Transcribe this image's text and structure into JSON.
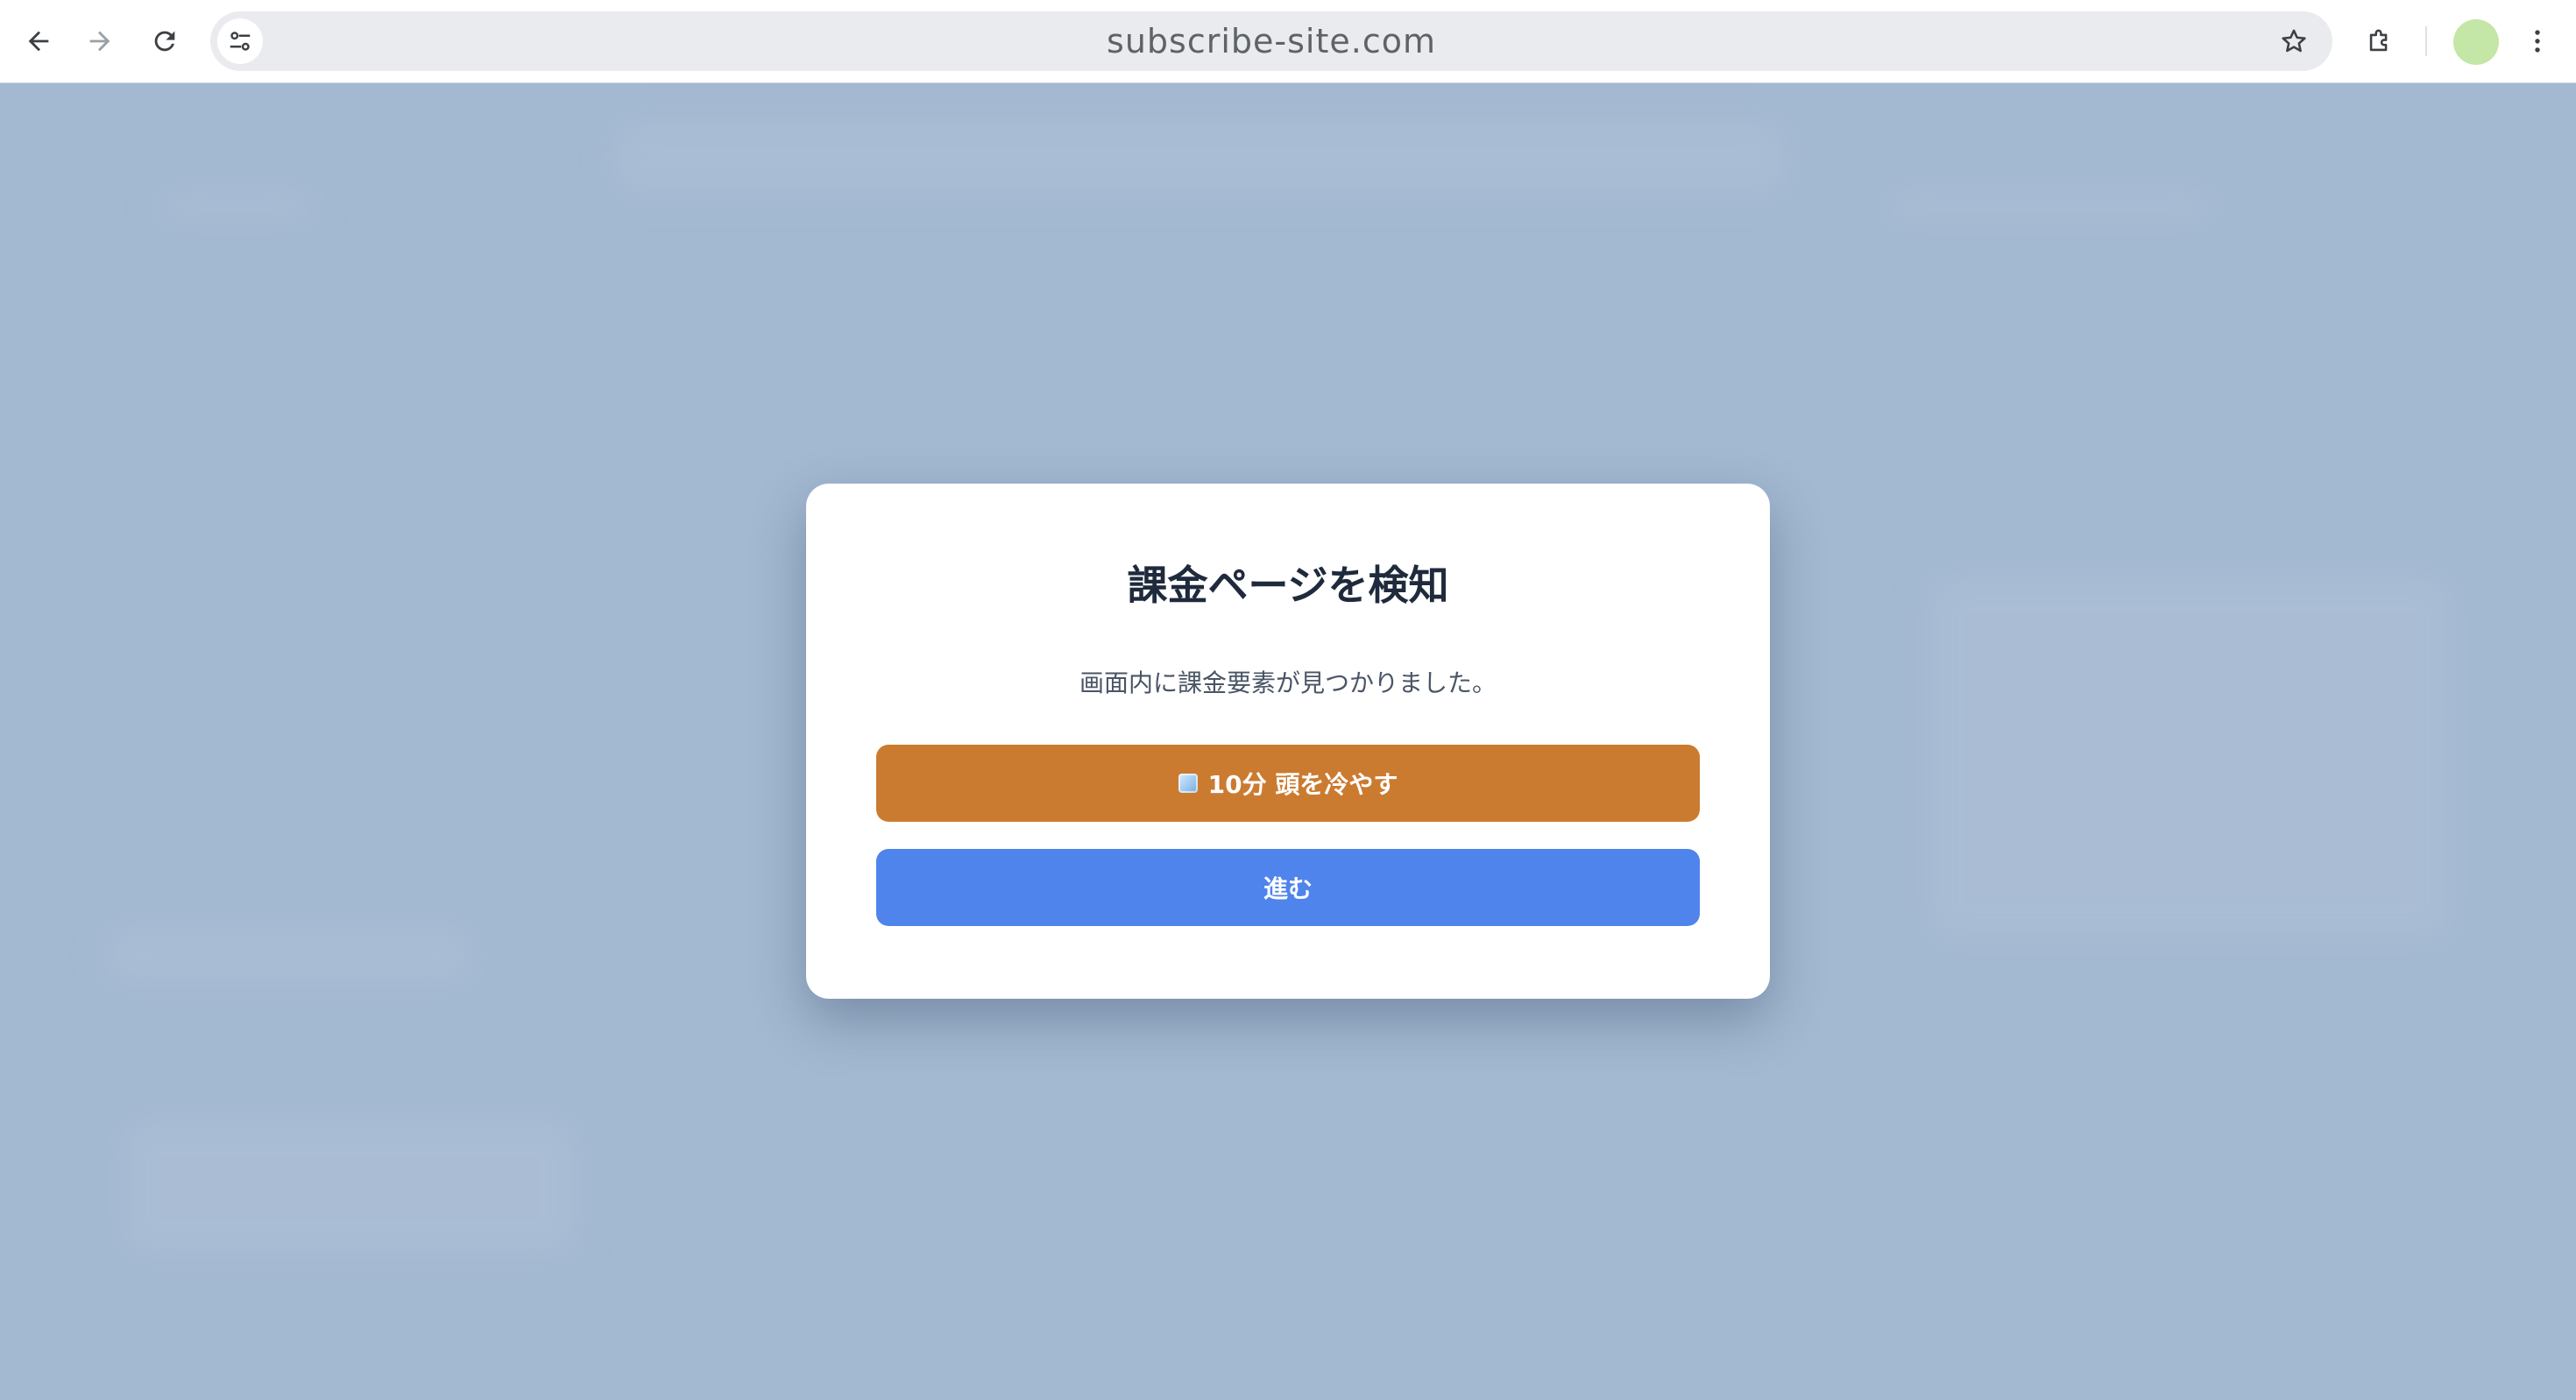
{
  "browser": {
    "url": "subscribe-site.com",
    "icons": {
      "back": "back-arrow-icon",
      "forward": "forward-arrow-icon",
      "reload": "reload-icon",
      "site_info": "tune-icon",
      "bookmark": "star-icon",
      "extensions": "puzzle-icon",
      "menu": "kebab-menu-icon"
    },
    "avatar_color": "#c4e6a6"
  },
  "dialog": {
    "title": "課金ページを検知",
    "message": "画面内に課金要素が見つかりました。",
    "cool_down_button": {
      "icon": "ice-cube-icon",
      "label": "10分 頭を冷やす",
      "color": "#cb7b30"
    },
    "proceed_button": {
      "label": "進む",
      "color": "#4f84ec"
    }
  },
  "colors": {
    "page_background": "#a3b8d1",
    "dialog_background": "#ffffff"
  }
}
